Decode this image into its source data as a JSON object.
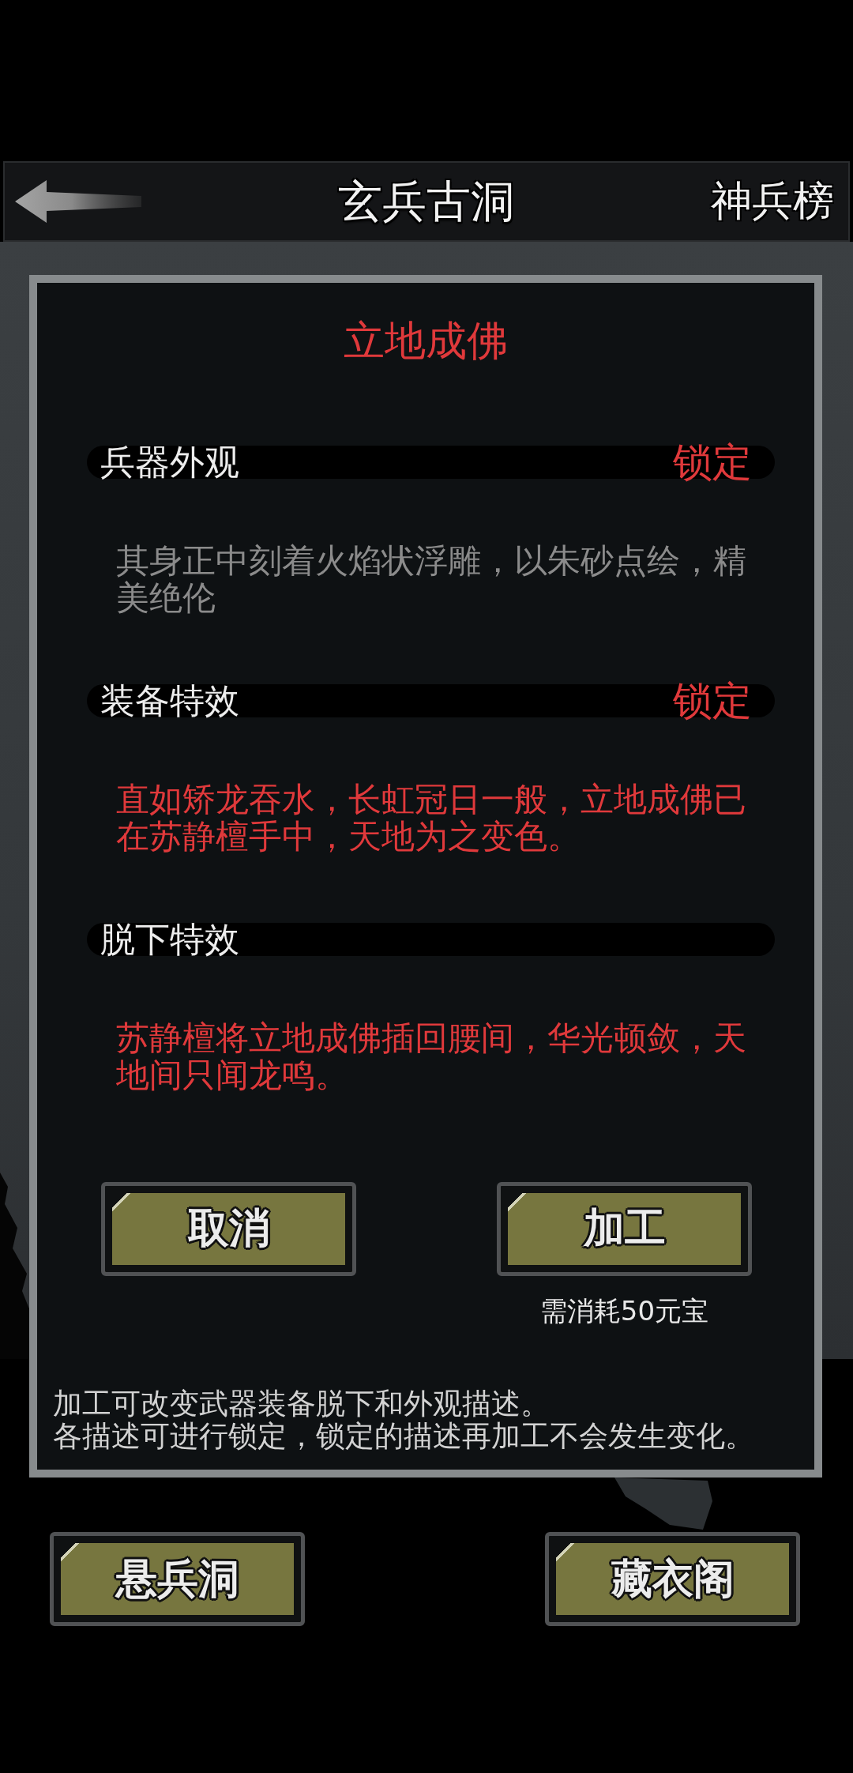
{
  "header": {
    "title": "玄兵古洞",
    "right_link": "神兵榜"
  },
  "dialog": {
    "title": "立地成佛",
    "sections": [
      {
        "label": "兵器外观",
        "lock_button": "锁定",
        "color": "#8b8b8b",
        "text": "其身正中刻着火焰状浮雕，以朱砂点绘，精美绝伦"
      },
      {
        "label": "装备特效",
        "lock_button": "锁定",
        "color": "#e0393b",
        "text": "直如矫龙吞水，长虹冠日一般，立地成佛已在苏静檀手中，天地为之变色。"
      },
      {
        "label": "脱下特效",
        "color": "#e0393b",
        "text": "苏静檀将立地成佛插回腰间，华光顿敛，天地间只闻龙鸣。"
      }
    ],
    "buttons": [
      {
        "label": "取消"
      },
      {
        "label": "加工",
        "cost_note": "需消耗50元宝"
      }
    ],
    "footnote": [
      "加工可改变武器装备脱下和外观描述。",
      "各描述可进行锁定，锁定的描述再加工不会发生变化。"
    ]
  },
  "bottom_buttons": [
    {
      "label": "悬兵洞"
    },
    {
      "label": "藏衣阁"
    }
  ]
}
